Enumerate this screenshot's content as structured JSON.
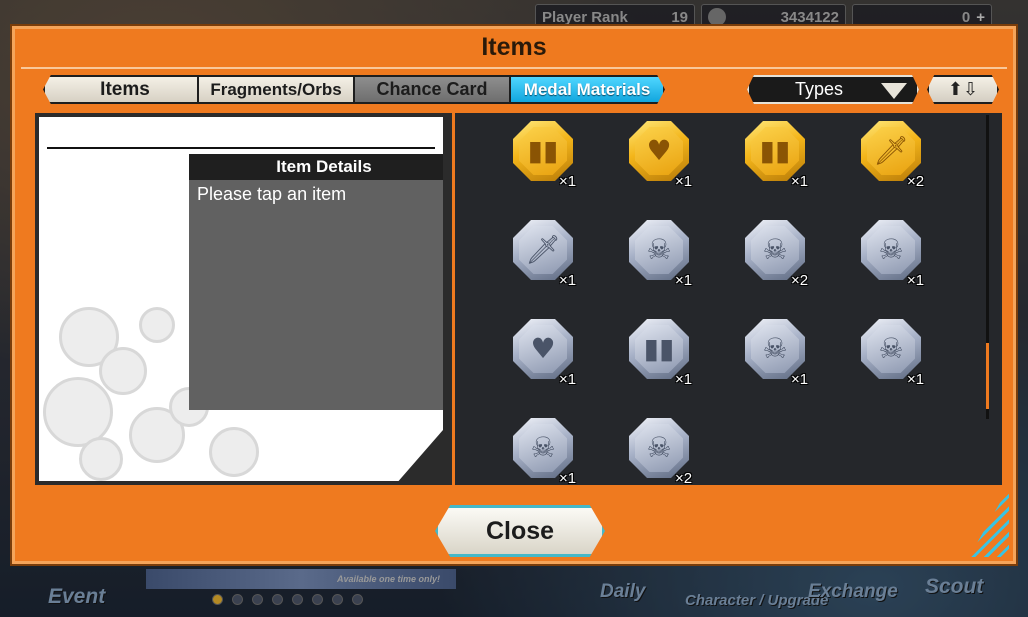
{
  "hud": {
    "rank_label": "Player Rank",
    "rank_value": "19",
    "money": "3434122",
    "gems": "0",
    "plus": "+"
  },
  "bottom_nav": {
    "event": "Event",
    "banner_note": "Available one time only!",
    "daily": "Daily",
    "character": "Character / Upgrade",
    "exchange": "Exchange",
    "scout": "Scout"
  },
  "modal": {
    "title": "Items",
    "tabs": [
      {
        "label": "Items",
        "active": false
      },
      {
        "label": "Fragments/Orbs",
        "active": false
      },
      {
        "label": "Chance Card",
        "active": false
      },
      {
        "label": "Medal Materials",
        "active": true
      }
    ],
    "types_label": "Types",
    "sort_label": "⬆⇩",
    "details": {
      "header": "Item Details",
      "body": "Please tap an item"
    },
    "close_label": "Close"
  },
  "medals": [
    {
      "tier": "gold",
      "icon": "armor-icon",
      "glyph": "▮▮",
      "count": "×1"
    },
    {
      "tier": "gold",
      "icon": "heart-icon",
      "glyph": "♥",
      "count": "×1"
    },
    {
      "tier": "gold",
      "icon": "armor-icon",
      "glyph": "▮▮",
      "count": "×1"
    },
    {
      "tier": "gold",
      "icon": "sword-icon",
      "glyph": "🗡",
      "count": "×2"
    },
    {
      "tier": "silver",
      "icon": "sword-icon",
      "glyph": "🗡",
      "count": "×1"
    },
    {
      "tier": "silver",
      "icon": "skull-icon",
      "glyph": "☠",
      "count": "×1"
    },
    {
      "tier": "silver",
      "icon": "skull-icon",
      "glyph": "☠",
      "count": "×2"
    },
    {
      "tier": "silver",
      "icon": "skull-icon",
      "glyph": "☠",
      "count": "×1"
    },
    {
      "tier": "silver",
      "icon": "heart-icon",
      "glyph": "♥",
      "count": "×1"
    },
    {
      "tier": "silver",
      "icon": "armor-icon",
      "glyph": "▮▮",
      "count": "×1"
    },
    {
      "tier": "silver",
      "icon": "skull-icon",
      "glyph": "☠",
      "count": "×1"
    },
    {
      "tier": "silver",
      "icon": "skull-icon",
      "glyph": "☠",
      "count": "×1"
    },
    {
      "tier": "silver",
      "icon": "skull-icon",
      "glyph": "☠",
      "count": "×1"
    },
    {
      "tier": "silver",
      "icon": "skull-icon",
      "glyph": "☠",
      "count": "×2"
    }
  ],
  "colors": {
    "frame_orange": "#ef7a1f",
    "active_tab": "#12a6de",
    "gold": "#f3b51a",
    "silver": "#a8b2c8"
  }
}
